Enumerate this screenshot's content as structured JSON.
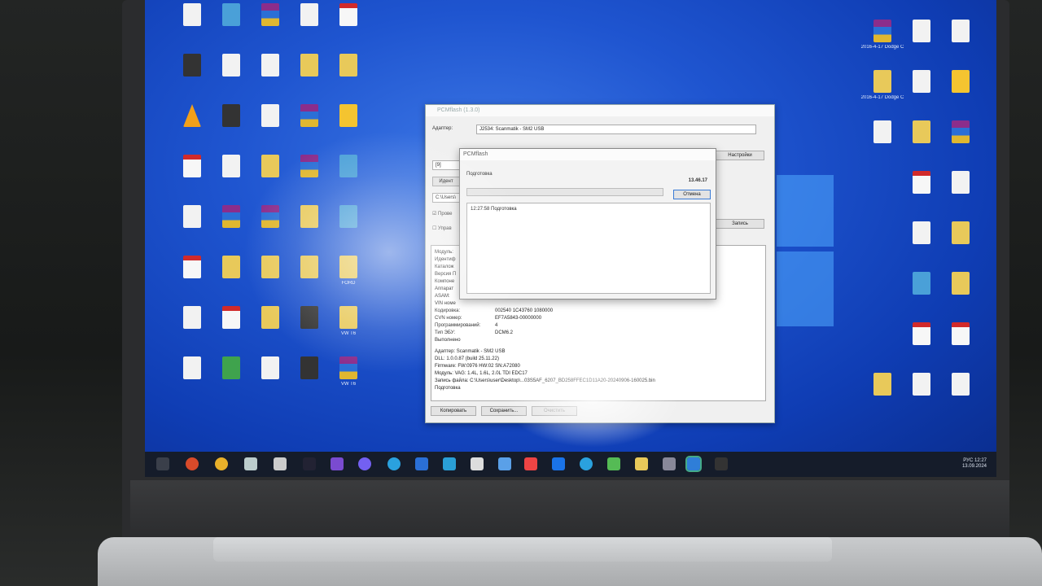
{
  "desktop": {
    "left_icons": [
      {
        "label": "",
        "kind": "file"
      },
      {
        "label": "",
        "kind": "net"
      },
      {
        "label": "",
        "kind": "rar"
      },
      {
        "label": "",
        "kind": "file"
      },
      {
        "label": "",
        "kind": "pdf"
      },
      {
        "label": "",
        "kind": "dark"
      },
      {
        "label": "",
        "kind": "file"
      },
      {
        "label": "",
        "kind": "file"
      },
      {
        "label": "",
        "kind": "folder"
      },
      {
        "label": "",
        "kind": "folder"
      },
      {
        "label": "",
        "kind": "warn"
      },
      {
        "label": "",
        "kind": "dark"
      },
      {
        "label": "",
        "kind": "file"
      },
      {
        "label": "",
        "kind": "rar"
      },
      {
        "label": "",
        "kind": "help"
      },
      {
        "label": "",
        "kind": "pdf"
      },
      {
        "label": "",
        "kind": "file"
      },
      {
        "label": "",
        "kind": "folder"
      },
      {
        "label": "",
        "kind": "rar"
      },
      {
        "label": "",
        "kind": "net"
      },
      {
        "label": "",
        "kind": "file"
      },
      {
        "label": "",
        "kind": "rar"
      },
      {
        "label": "",
        "kind": "rar"
      },
      {
        "label": "",
        "kind": "folder"
      },
      {
        "label": "",
        "kind": "net"
      },
      {
        "label": "",
        "kind": "pdf"
      },
      {
        "label": "",
        "kind": "folder"
      },
      {
        "label": "",
        "kind": "folder"
      },
      {
        "label": "",
        "kind": "folder"
      },
      {
        "label": "FORD",
        "kind": "folder"
      },
      {
        "label": "",
        "kind": "file"
      },
      {
        "label": "",
        "kind": "pdf"
      },
      {
        "label": "",
        "kind": "folder"
      },
      {
        "label": "",
        "kind": "dark"
      },
      {
        "label": "VW T6",
        "kind": "folder"
      },
      {
        "label": "",
        "kind": "file"
      },
      {
        "label": "",
        "kind": "green"
      },
      {
        "label": "",
        "kind": "file"
      },
      {
        "label": "",
        "kind": "dark"
      },
      {
        "label": "VW T6",
        "kind": "rar"
      }
    ],
    "right_icons": [
      {
        "label": "2016-4-17 Dodge C",
        "kind": "rar"
      },
      {
        "label": "",
        "kind": "file"
      },
      {
        "label": "",
        "kind": "file"
      },
      {
        "label": "2016-4-17 Dodge C",
        "kind": "folder"
      },
      {
        "label": "",
        "kind": "file"
      },
      {
        "label": "",
        "kind": "help"
      },
      {
        "label": "",
        "kind": "file"
      },
      {
        "label": "",
        "kind": "folder"
      },
      {
        "label": "",
        "kind": "rar"
      },
      {
        "label": "",
        "kind": "pdf"
      },
      {
        "label": "",
        "kind": "file"
      },
      {
        "label": "",
        "kind": "file"
      },
      {
        "label": "",
        "kind": "folder"
      },
      {
        "label": "",
        "kind": "net"
      },
      {
        "label": "",
        "kind": "folder"
      },
      {
        "label": "",
        "kind": "pdf"
      },
      {
        "label": "",
        "kind": "pdf"
      },
      {
        "label": "",
        "kind": "folder"
      },
      {
        "label": "",
        "kind": "file"
      },
      {
        "label": "",
        "kind": "file"
      }
    ]
  },
  "pcmflash": {
    "window_title": "PCMflash (1.3.0)",
    "adapter_label": "Адаптер:",
    "adapter_value": "J2534: Scanmatik - SM2 USB",
    "settings_button": "Настройки",
    "path_value": "C:\\Users\\",
    "write_button": "Запись",
    "check1_label": "Прове",
    "check2_label": "Управ",
    "identify_label": "Идент",
    "info_labels": [
      "Модуль:",
      "Идентиф",
      "Каталож",
      "Версия П",
      "Компоне",
      "Аппарат",
      "ASAM:",
      "VIN номе",
      "Кодировка:",
      "CVN номер:",
      "Программирований:",
      "Тип ЭБУ:",
      "Выполнено"
    ],
    "info_values": [
      "002540 1C43760 1080000",
      "EF7A5843-00000000",
      "4",
      "DCM6.2"
    ],
    "log_lines": [
      "Адаптер: Scanmatik - SM2 USB",
      "DLL: 1.0.0.87 (build 25.11.22)",
      "Firmware: FW:0976 HW:02 SN:A72080",
      "Модуль: VAG: 1.4L, 1.6L, 2.0L TDI EDC17",
      "Запись файла: C:\\Users\\user\\Desktop\\...03S5AF_6207_BD258FFEC1D11A20-20240906-160025.bin",
      "Подготовка"
    ],
    "copy_button": "Копировать",
    "save_button": "Сохранить...",
    "clear_button": "Очистить"
  },
  "progress_dialog": {
    "title": "PCMflash",
    "status": "Подготовка",
    "elapsed": "13.46.17",
    "cancel_button": "Отмена",
    "progress": 0.0,
    "log_line": "12:27:58 Подготовка"
  },
  "taskbar": {
    "tray_lang": "РУС",
    "clock_time": "12:27",
    "clock_date": "13.09.2024"
  },
  "colors": {
    "desktop_blue": "#1f55d0",
    "taskbar": "#151c2a",
    "progress_fill": "#06b025"
  }
}
